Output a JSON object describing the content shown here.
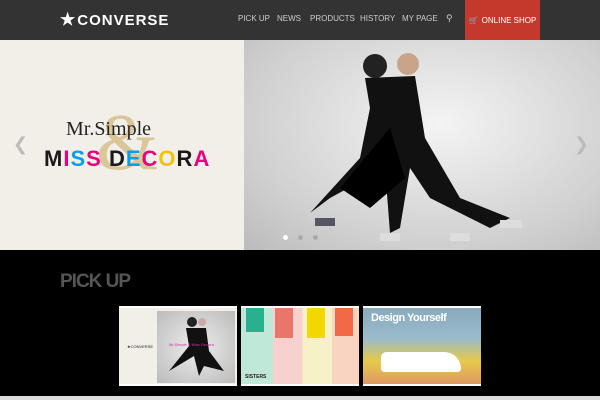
{
  "header": {
    "logo": "CONVERSE",
    "nav": [
      "PICK UP",
      "NEWS",
      "PRODUCTS",
      "HISTORY",
      "MY PAGE"
    ],
    "search_icon": "search-icon",
    "shop_label": "ONLINE SHOP",
    "shop_color": "#c5392c"
  },
  "hero": {
    "title_line1": "Mr.Simple",
    "title_line2": "MISS DECORA",
    "amp": "&",
    "slides": 3,
    "active_slide": 1
  },
  "pickup": {
    "heading": "PICK UP",
    "items": [
      {
        "label": "Mr.Simple & Miss Decora"
      },
      {
        "label": "SISTERS"
      },
      {
        "label": "Design Yourself"
      }
    ]
  }
}
